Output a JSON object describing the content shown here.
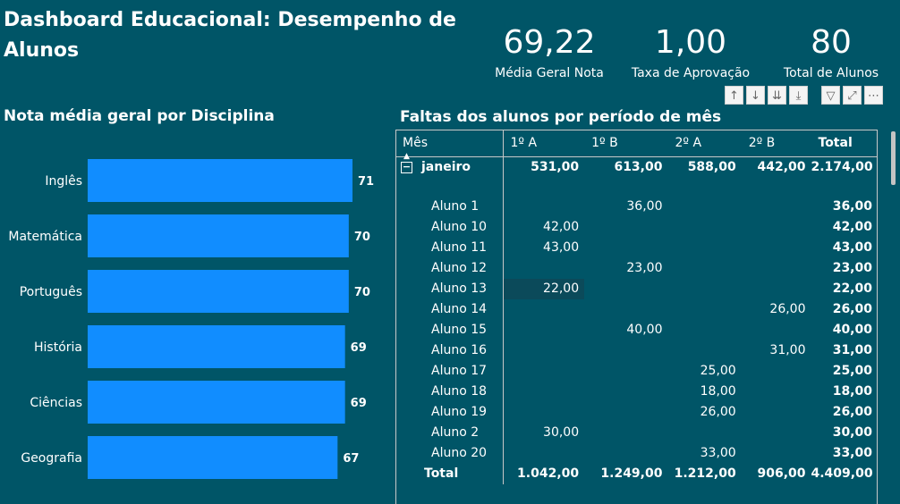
{
  "title": "Dashboard Educacional: Desempenho de Alunos",
  "kpis": [
    {
      "value": "69,22",
      "label": "Média Geral Nota"
    },
    {
      "value": "1,00",
      "label": "Taxa de Aprovação"
    },
    {
      "value": "80",
      "label": "Total de Alunos"
    }
  ],
  "toolbar": {
    "icons": [
      "drill-up-icon",
      "drill-down-icon",
      "expand-next-level-icon",
      "expand-hierarchy-icon",
      "filter-icon",
      "focus-mode-icon",
      "more-options-icon"
    ],
    "glyphs": [
      "↑",
      "↓",
      "⇊",
      "⤓",
      "▽",
      "⤢",
      "⋯"
    ]
  },
  "chart_data": {
    "type": "bar",
    "orientation": "horizontal",
    "title": "Nota média geral por Disciplina",
    "categories": [
      "Inglês",
      "Matemática",
      "Português",
      "História",
      "Ciências",
      "Geografia"
    ],
    "values": [
      71,
      70,
      70,
      69,
      69,
      67
    ],
    "value_labels": [
      "71",
      "70",
      "70",
      "69",
      "69",
      "67"
    ],
    "bar_color": "#118dff",
    "xlim": [
      0,
      71
    ]
  },
  "matrix": {
    "title": "Faltas dos alunos por período de mês",
    "headers": [
      "Mês",
      "1º A",
      "1º B",
      "2º A",
      "2º B",
      "Total"
    ],
    "group": {
      "label": "janeiro",
      "values": [
        "531,00",
        "613,00",
        "588,00",
        "442,00",
        "2.174,00"
      ]
    },
    "rows": [
      {
        "label": "Aluno 1",
        "values": [
          "",
          "36,00",
          "",
          "",
          "36,00"
        ]
      },
      {
        "label": "Aluno 10",
        "values": [
          "42,00",
          "",
          "",
          "",
          "42,00"
        ]
      },
      {
        "label": "Aluno 11",
        "values": [
          "43,00",
          "",
          "",
          "",
          "43,00"
        ]
      },
      {
        "label": "Aluno 12",
        "values": [
          "",
          "23,00",
          "",
          "",
          "23,00"
        ]
      },
      {
        "label": "Aluno 13",
        "values": [
          "22,00",
          "",
          "",
          "",
          "22,00"
        ]
      },
      {
        "label": "Aluno 14",
        "values": [
          "",
          "",
          "",
          "26,00",
          "26,00"
        ]
      },
      {
        "label": "Aluno 15",
        "values": [
          "",
          "40,00",
          "",
          "",
          "40,00"
        ]
      },
      {
        "label": "Aluno 16",
        "values": [
          "",
          "",
          "",
          "31,00",
          "31,00"
        ]
      },
      {
        "label": "Aluno 17",
        "values": [
          "",
          "",
          "25,00",
          "",
          "25,00"
        ]
      },
      {
        "label": "Aluno 18",
        "values": [
          "",
          "",
          "18,00",
          "",
          "18,00"
        ]
      },
      {
        "label": "Aluno 19",
        "values": [
          "",
          "",
          "26,00",
          "",
          "26,00"
        ]
      },
      {
        "label": "Aluno 2",
        "values": [
          "30,00",
          "",
          "",
          "",
          "30,00"
        ]
      },
      {
        "label": "Aluno 20",
        "values": [
          "",
          "",
          "33,00",
          "",
          "33,00"
        ]
      }
    ],
    "total": {
      "label": "Total",
      "values": [
        "1.042,00",
        "1.249,00",
        "1.212,00",
        "906,00",
        "4.409,00"
      ]
    }
  }
}
